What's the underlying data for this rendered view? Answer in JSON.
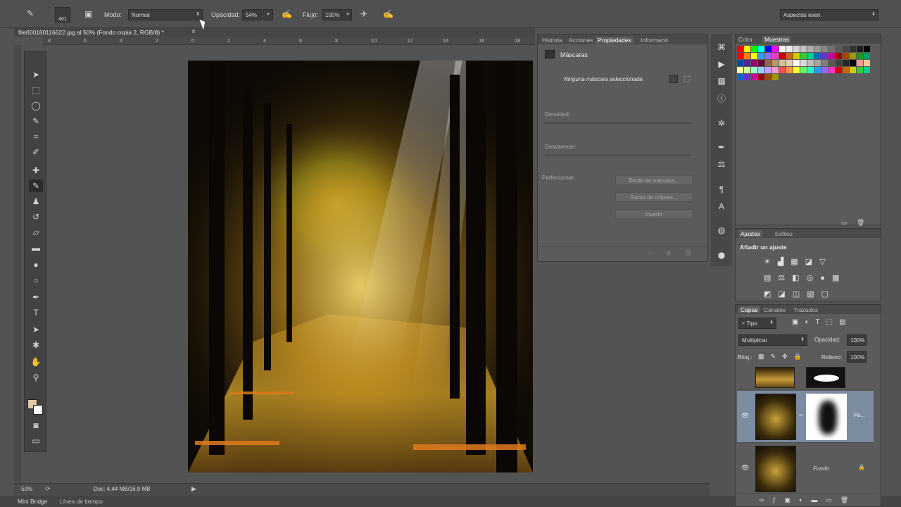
{
  "options_bar": {
    "mode_label": "Modo:",
    "mode_value": "Normal",
    "opacity_label": "Opacidad:",
    "opacity_value": "54%",
    "flow_label": "Flujo:",
    "flow_value": "100%",
    "brush_size": "401",
    "workspace": "Aspectos esen."
  },
  "document": {
    "tab_title": "file000180116622.jpg al 50% (Fondo copia 2, RGB/8) *",
    "close": "×"
  },
  "ruler_h": [
    "8",
    "6",
    "4",
    "2",
    "0",
    "2",
    "4",
    "6",
    "8",
    "10",
    "12",
    "14",
    "16",
    "18"
  ],
  "status": {
    "zoom": "50%",
    "doc": "Doc: 4,44 MB/16,9 MB"
  },
  "bottom_tabs": [
    "Mini Bridge",
    "Línea de tiempo"
  ],
  "properties": {
    "tabs": [
      "Historia",
      "Acciones",
      "Propiedades",
      "Informació"
    ],
    "active_tab": "Propiedades",
    "section": "Máscaras",
    "no_mask": "Ninguna máscara seleccionada",
    "density": "Densidad:",
    "feather": "Desvanecer:",
    "refine": "Perfeccionar:",
    "btn_mask_edge": "Borde de máscara...",
    "btn_color_range": "Gama de colores...",
    "btn_invert": "Invertir"
  },
  "swatches_panel": {
    "tabs": [
      "Color",
      "Muestras"
    ],
    "colors": [
      "#ff0000",
      "#ffff00",
      "#00ff00",
      "#00ffff",
      "#0000ff",
      "#ff00ff",
      "#ffffff",
      "#ebebeb",
      "#d6d6d6",
      "#c2c2c2",
      "#adadad",
      "#999999",
      "#858585",
      "#707070",
      "#5c5c5c",
      "#474747",
      "#333333",
      "#1f1f1f",
      "#000000",
      "#ff0000",
      "#ff8000",
      "#ffff00"
    ]
  },
  "adjustments": {
    "tabs": [
      "Ajustes",
      "Estilos"
    ],
    "title": "Añadir un ajuste"
  },
  "layers": {
    "tabs": [
      "Capas",
      "Canales",
      "Trazados"
    ],
    "filter": "Tipo",
    "blend_mode": "Multiplicar",
    "opacity_label": "Opacidad:",
    "opacity_value": "100%",
    "lock_label": "Bloq.:",
    "fill_label": "Relleno:",
    "fill_value": "100%",
    "items": [
      {
        "name": ""
      },
      {
        "name": "Fo..."
      },
      {
        "name": "Fondo"
      }
    ]
  }
}
